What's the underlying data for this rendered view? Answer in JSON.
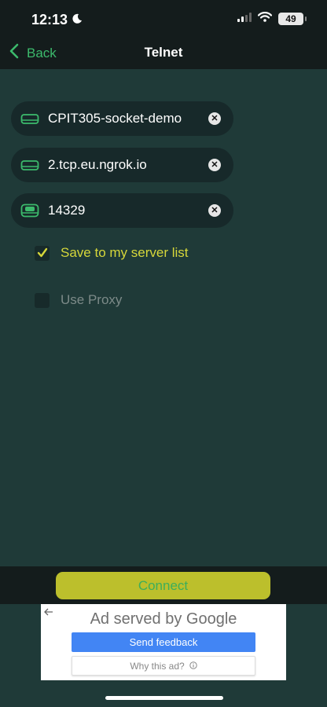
{
  "status_bar": {
    "time": "12:13",
    "battery": "49"
  },
  "nav": {
    "back_label": "Back",
    "title": "Telnet"
  },
  "fields": [
    {
      "value": "CPIT305-socket-demo",
      "icon": "server-icon"
    },
    {
      "value": "2.tcp.eu.ngrok.io",
      "icon": "server-icon"
    },
    {
      "value": "14329",
      "icon": "server-port-icon"
    }
  ],
  "options": {
    "save_label": "Save to my server list",
    "save_checked": true,
    "proxy_label": "Use Proxy",
    "proxy_checked": false
  },
  "connect_label": "Connect",
  "ad": {
    "title_prefix": "Ad served by",
    "brand": "Google",
    "feedback_label": "Send feedback",
    "why_label": "Why this ad?"
  },
  "colors": {
    "background": "#1f3a38",
    "bar": "#141c1c",
    "accent_green": "#3cba6c",
    "connect_button": "#bcbf2c",
    "checkbox_tick": "#d6d73a"
  }
}
